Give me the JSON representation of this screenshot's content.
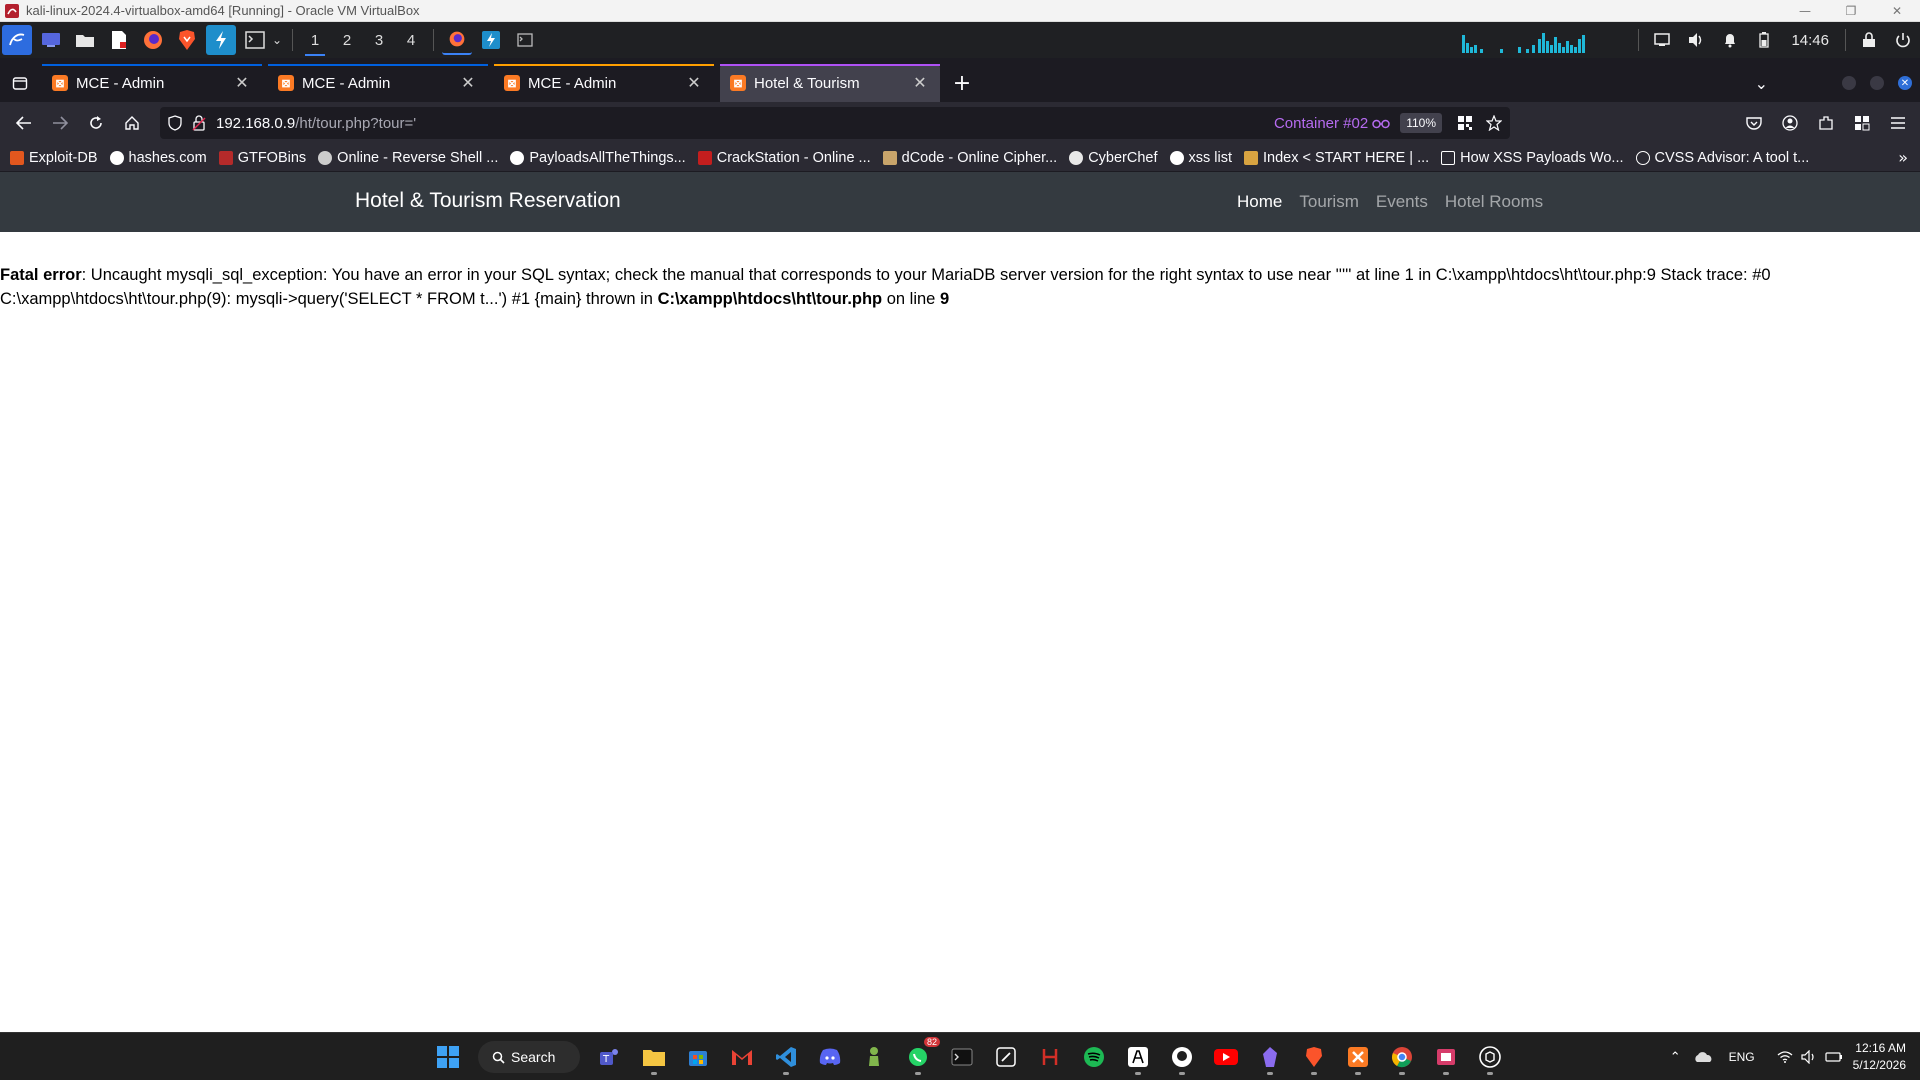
{
  "vbox": {
    "title": "kali-linux-2024.4-virtualbox-amd64 [Running] - Oracle VM VirtualBox",
    "minimize": "—",
    "restore": "❐",
    "close": "✕"
  },
  "kali_panel": {
    "workspaces": [
      "1",
      "2",
      "3",
      "4"
    ],
    "active_workspace": "1",
    "clock": "14:46"
  },
  "tabs": [
    {
      "label": "MCE - Admin",
      "context_color": "#0060df",
      "active": false
    },
    {
      "label": "MCE - Admin",
      "context_color": "#0060df",
      "active": false
    },
    {
      "label": "MCE - Admin",
      "context_color": "#ff9f00",
      "active": false
    },
    {
      "label": "Hotel & Tourism",
      "context_color": "#af51f5",
      "active": true
    }
  ],
  "urlbar": {
    "host": "192.168.0.9",
    "path": "/ht/tour.php?tour='",
    "container": "Container #02",
    "zoom": "110%"
  },
  "bookmarks": [
    {
      "label": "Exploit-DB",
      "color": "#e2571e"
    },
    {
      "label": "hashes.com",
      "color": "#ffffff"
    },
    {
      "label": "GTFOBins",
      "color": "#b52a2a"
    },
    {
      "label": "Online - Reverse Shell ...",
      "color": "#cccccc"
    },
    {
      "label": "PayloadsAllTheThings...",
      "color": "#ffffff"
    },
    {
      "label": "CrackStation - Online ...",
      "color": "#c41e1e"
    },
    {
      "label": "dCode - Online Cipher...",
      "color": "#c9a56b"
    },
    {
      "label": "CyberChef",
      "color": "#e8e8e8"
    },
    {
      "label": "xss list",
      "color": "#ffffff"
    },
    {
      "label": "Index < START HERE | ...",
      "color": "#d9a441"
    },
    {
      "label": "How XSS Payloads Wo...",
      "color": "#ffffff"
    },
    {
      "label": "CVSS Advisor: A tool t...",
      "color": "#ffffff"
    }
  ],
  "site": {
    "brand": "Hotel & Tourism Reservation",
    "nav": [
      "Home",
      "Tourism",
      "Events",
      "Hotel Rooms"
    ],
    "active_nav": "Home"
  },
  "error": {
    "label": "Fatal error",
    "message": ": Uncaught mysqli_sql_exception: You have an error in your SQL syntax; check the manual that corresponds to your MariaDB server version for the right syntax to use near ''''' at line 1 in C:\\xampp\\htdocs\\ht\\tour.php:9 Stack trace: #0 C:\\xampp\\htdocs\\ht\\tour.php(9): mysqli->query('SELECT * FROM t...') #1 {main} thrown in ",
    "file": "C:\\xampp\\htdocs\\ht\\tour.php",
    "on_line": " on line ",
    "line": "9"
  },
  "taskbar": {
    "search_label": "Search",
    "whatsapp_badge": "82",
    "lang": "ENG",
    "time": "12:16 AM",
    "date": "5/12/2026"
  },
  "colors": {
    "firefox_toolbar": "#2b2a33",
    "firefox_tabstrip": "#1c1b22",
    "site_nav": "#343a40",
    "container_purple": "#b66bf0"
  }
}
